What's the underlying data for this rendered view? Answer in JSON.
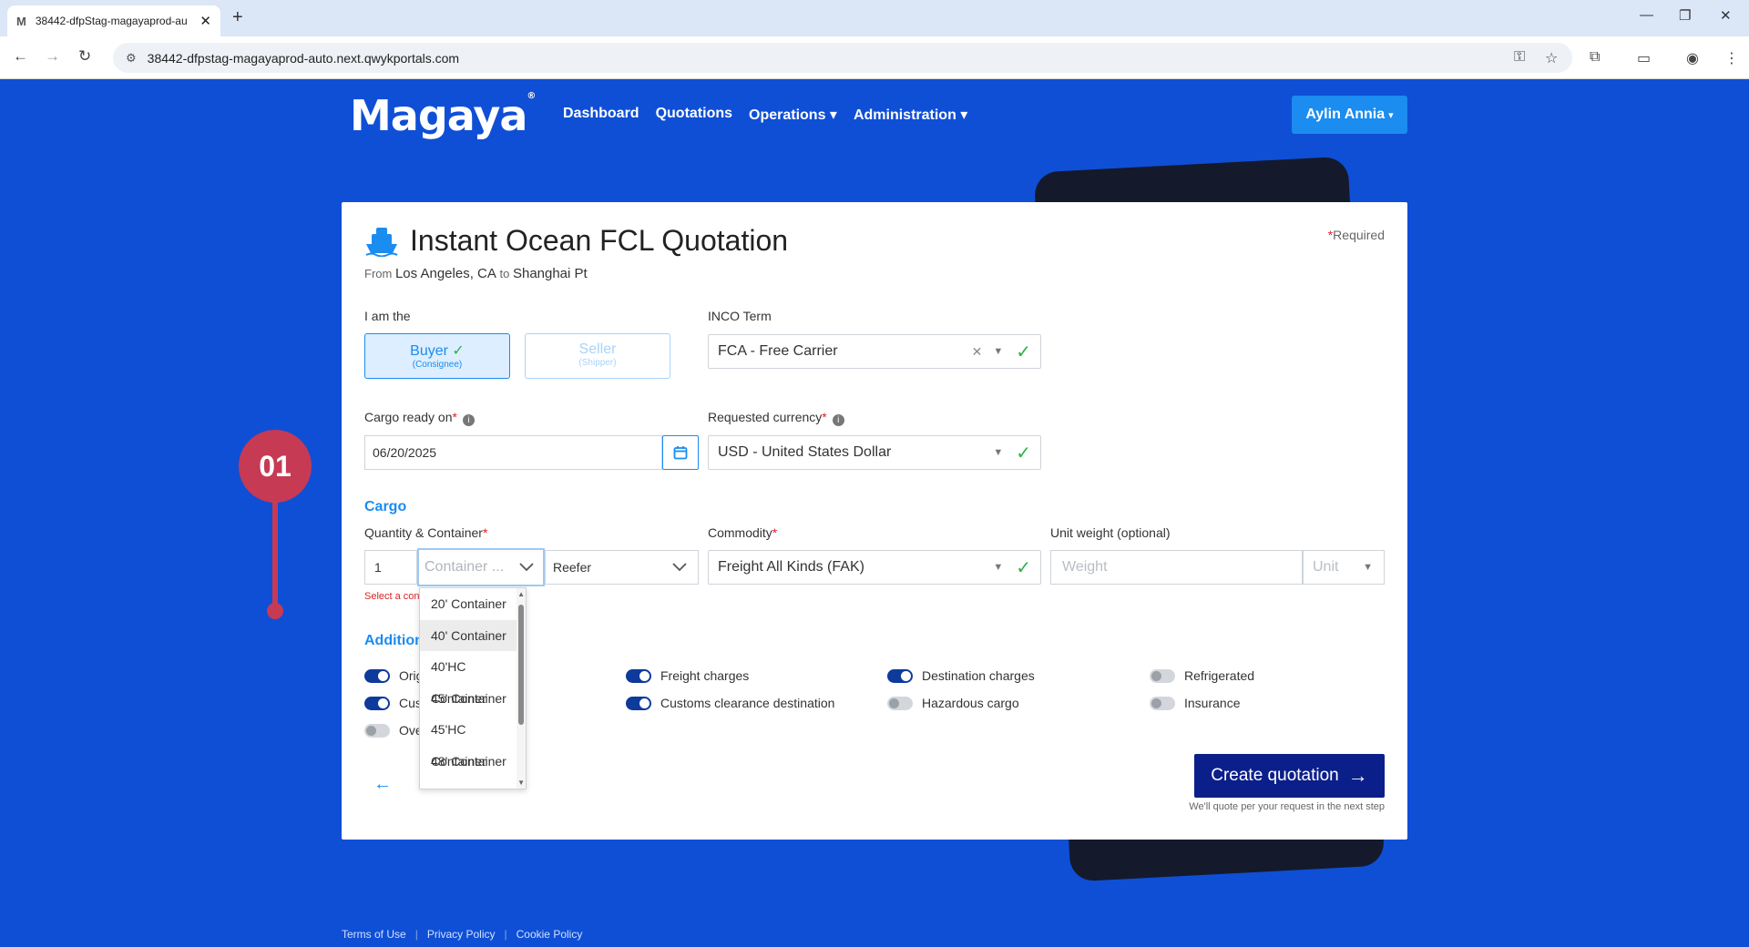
{
  "browser": {
    "tab_title": "38442-dfpStag-magayaprod-au",
    "url": "38442-dfpstag-magayaprod-auto.next.qwykportals.com",
    "tab_favicon": "M"
  },
  "header": {
    "logo": "Magaya",
    "nav": [
      "Dashboard",
      "Quotations",
      "Operations ▾",
      "Administration ▾"
    ],
    "user_label": "Aylin Annia"
  },
  "step_marker": "01",
  "card": {
    "title": "Instant Ocean FCL Quotation",
    "route_from_label": "From",
    "route_origin": "Los Angeles, CA",
    "route_to_label": "to",
    "route_destination": "Shanghai Pt",
    "required_note": "Required",
    "role": {
      "label": "I am the",
      "buyer": "Buyer",
      "buyer_sub": "(Consignee)",
      "seller": "Seller",
      "seller_sub": "(Shipper)"
    },
    "inco": {
      "label": "INCO Term",
      "value": "FCA - Free Carrier"
    },
    "cargo_ready": {
      "label": "Cargo ready on",
      "value": "06/20/2025"
    },
    "currency": {
      "label": "Requested currency",
      "value": "USD - United States Dollar"
    },
    "cargo_section": "Cargo",
    "quantity": {
      "label": "Quantity & Container",
      "qty": "1",
      "container_placeholder": "Container ...",
      "reefer": "Reefer",
      "error": "Select a con"
    },
    "commodity": {
      "label": "Commodity",
      "value": "Freight All Kinds (FAK)"
    },
    "weight": {
      "label": "Unit weight (optional)",
      "placeholder": "Weight",
      "unit_placeholder": "Unit"
    },
    "additional_section": "Addition",
    "services": [
      {
        "label": "Orig",
        "on": true
      },
      {
        "label": "Cus",
        "on": true
      },
      {
        "label": "Ove",
        "on": false
      },
      {
        "label": "Freight charges",
        "on": true
      },
      {
        "label": "Customs clearance destination",
        "on": true
      },
      {
        "label": "Destination charges",
        "on": true
      },
      {
        "label": "Hazardous cargo",
        "on": false
      },
      {
        "label": "Refrigerated",
        "on": false
      },
      {
        "label": "Insurance",
        "on": false
      }
    ],
    "container_options": [
      "20' Container",
      "40' Container",
      "40'HC Container",
      "45' Container",
      "45'HC Container",
      "48' Container"
    ],
    "create_button": "Create quotation",
    "create_note": "We'll quote per your request in the next step"
  },
  "footer": [
    "Terms of Use",
    "Privacy Policy",
    "Cookie Policy"
  ],
  "colors": {
    "primary": "#1b8cf0",
    "dark_button": "#0b1f8a",
    "background": "#0f4fd6",
    "accent_red": "#c63a54",
    "success": "#2db24a"
  }
}
